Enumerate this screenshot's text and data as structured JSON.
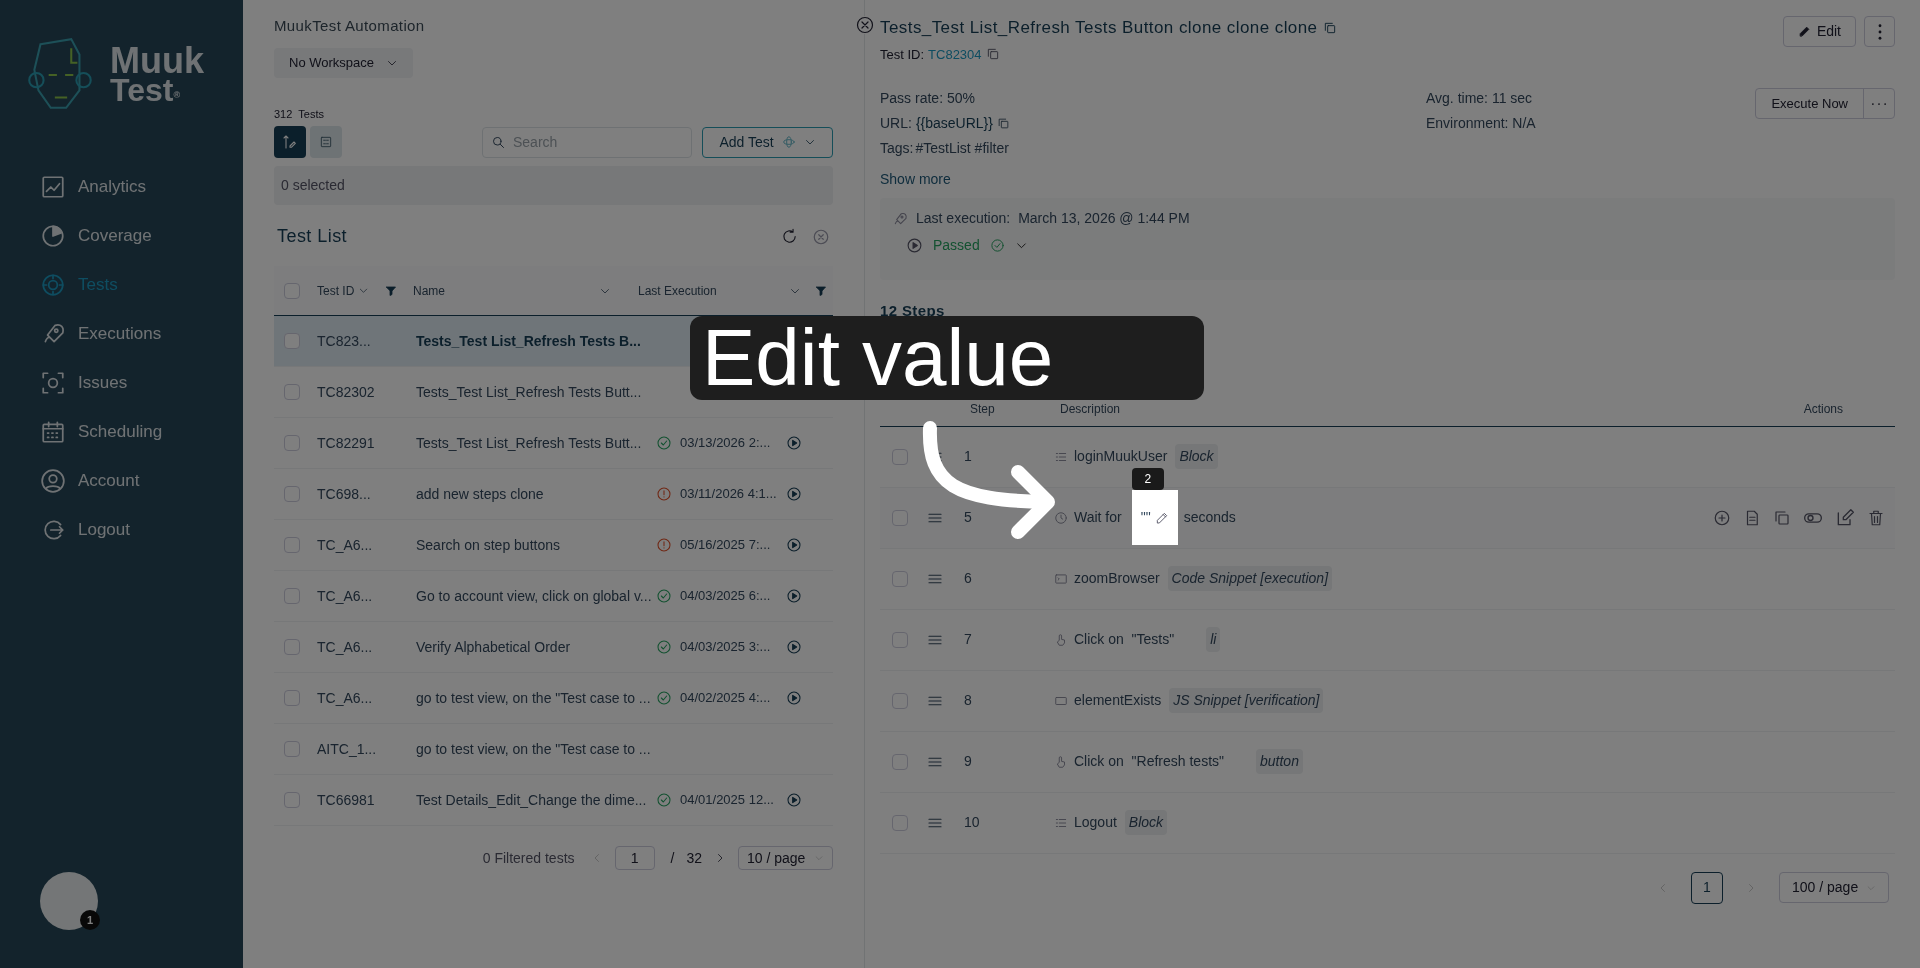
{
  "sidebar": {
    "logo": {
      "line1": "Muuk",
      "line2": "Test",
      "mark": "®"
    },
    "items": [
      {
        "label": "Analytics",
        "selected": false
      },
      {
        "label": "Coverage",
        "selected": false
      },
      {
        "label": "Tests",
        "selected": true
      },
      {
        "label": "Executions",
        "selected": false
      },
      {
        "label": "Issues",
        "selected": false
      },
      {
        "label": "Scheduling",
        "selected": false
      },
      {
        "label": "Account",
        "selected": false
      },
      {
        "label": "Logout",
        "selected": false
      }
    ],
    "avatar_badge": "1"
  },
  "list_panel": {
    "project": "MuukTest Automation",
    "workspace": "No Workspace",
    "test_count": "312",
    "test_count_label": "Tests",
    "view_toggle": [
      {
        "selected": true
      },
      {
        "selected": false
      }
    ],
    "all_checked": false,
    "search": {
      "placeholder": "Search"
    },
    "add_button": "Add Test",
    "selection": "0 selected",
    "title": "Test List",
    "columns": [
      "Test ID",
      "Name",
      "Last Execution"
    ],
    "rows": [
      {
        "id": "TC823...",
        "name": "Tests_Test List_Refresh Tests B...",
        "selected": true,
        "checked": false
      },
      {
        "id": "TC82302",
        "name": "Tests_Test List_Refresh Tests Butt...",
        "selected": false,
        "checked": false
      },
      {
        "id": "TC82291",
        "name": "Tests_Test List_Refresh Tests Butt...",
        "kind": "passed",
        "last_execution": "03/13/2026 2:...",
        "selected": false,
        "checked": false
      },
      {
        "id": "TC698...",
        "name": "add new steps clone",
        "kind": "failed",
        "last_execution": "03/11/2026 4:1...",
        "selected": false,
        "checked": false
      },
      {
        "id": "TC_A6...",
        "name": "Search on step buttons",
        "kind": "failed",
        "last_execution": "05/16/2025 7:...",
        "selected": false,
        "checked": false
      },
      {
        "id": "TC_A6...",
        "name": "Go to account view, click on global v...",
        "kind": "passed",
        "last_execution": "04/03/2025 6:...",
        "selected": false,
        "checked": false
      },
      {
        "id": "TC_A6...",
        "name": "Verify Alphabetical Order",
        "kind": "passed",
        "last_execution": "04/03/2025 3:...",
        "selected": false,
        "checked": false
      },
      {
        "id": "TC_A6...",
        "name": "go to test view, on the \"Test case to ...",
        "kind": "passed",
        "last_execution": "04/02/2025 4:...",
        "selected": false,
        "checked": false
      },
      {
        "id": "AITC_1...",
        "name": "go to test view, on the \"Test case to ...",
        "selected": false,
        "checked": false
      },
      {
        "id": "TC66981",
        "name": "Test Details_Edit_Change the dime...",
        "kind": "passed",
        "last_execution": "04/01/2025 12...",
        "selected": false,
        "checked": false
      }
    ],
    "pagination": {
      "filtered": "0 Filtered tests",
      "page": "1",
      "separator": "/",
      "total": "32",
      "page_size": "10 / page"
    }
  },
  "detail": {
    "title": "Tests_Test List_Refresh Tests Button clone clone clone",
    "test_id_label": "Test ID:",
    "test_id": "TC82304",
    "edit_button": "Edit",
    "execute_button": "Execute Now",
    "pass_rate": "Pass rate: 50%",
    "url_label": "URL:",
    "url": "{{baseURL}}",
    "tags_label": "Tags:",
    "tags": "#TestList #filter",
    "avg_time": "Avg. time: 11 sec",
    "environment": "Environment: N/A",
    "show_more": "Show more",
    "last_execution_label": "Last execution:",
    "last_execution": "March 13, 2026 @ 1:44 PM",
    "result": "Passed",
    "steps_title": "12 Steps",
    "step_columns": [
      "Step",
      "Description",
      "Actions"
    ],
    "steps": [
      {
        "number": "1",
        "kind": "block",
        "text": "loginMuukUser",
        "tag": "Block",
        "checked": false
      },
      {
        "number": "5",
        "kind": "wait",
        "text": "Wait for",
        "value": "\"\"",
        "unit": "seconds",
        "tooltip": "2",
        "checked": false
      },
      {
        "number": "6",
        "kind": "snippet",
        "text": "zoomBrowser",
        "tag": "Code Snippet [execution]",
        "checked": false
      },
      {
        "number": "7",
        "kind": "click",
        "text": "Click on  \"Tests\"",
        "tag": "li",
        "checked": false
      },
      {
        "number": "8",
        "kind": "verify",
        "text": "elementExists",
        "tag": "JS Snippet [verification]",
        "checked": false
      },
      {
        "number": "9",
        "kind": "click",
        "text": "Click on  \"Refresh tests\"",
        "tag": "button",
        "checked": false
      },
      {
        "number": "10",
        "kind": "block",
        "text": "Logout",
        "tag": "Block",
        "checked": false
      }
    ],
    "pagination": {
      "page": "1",
      "page_size": "100 / page"
    }
  },
  "callout": {
    "text": "Edit value"
  }
}
